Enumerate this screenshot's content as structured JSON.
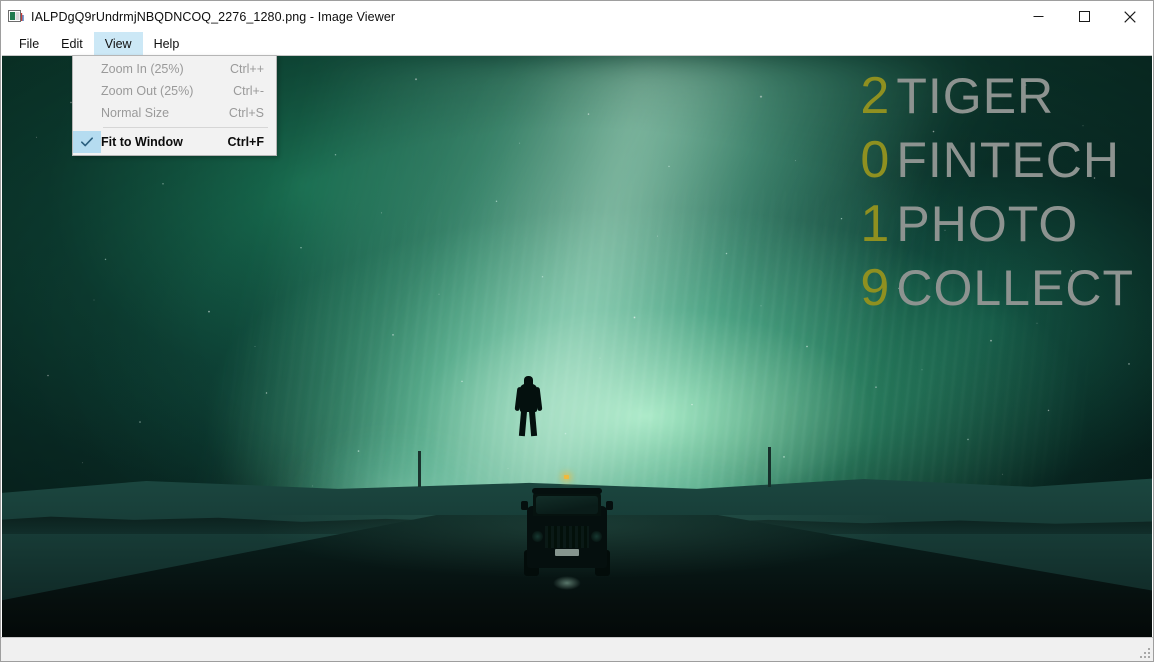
{
  "window": {
    "title": "IALPDgQ9rUndrmjNBQDNCOQ_2276_1280.png - Image Viewer",
    "app_icon": "image-file-icon",
    "controls": {
      "minimize_label": "Minimize",
      "maximize_label": "Maximize",
      "close_label": "Close"
    }
  },
  "menubar": {
    "items": [
      {
        "label": "File",
        "active": false
      },
      {
        "label": "Edit",
        "active": false
      },
      {
        "label": "View",
        "active": true
      },
      {
        "label": "Help",
        "active": false
      }
    ]
  },
  "view_menu": {
    "open": true,
    "items": [
      {
        "label": "Zoom In (25%)",
        "accel": "Ctrl++",
        "enabled": false,
        "checked": false
      },
      {
        "label": "Zoom Out (25%)",
        "accel": "Ctrl+-",
        "enabled": false,
        "checked": false
      },
      {
        "label": "Normal Size",
        "accel": "Ctrl+S",
        "enabled": false,
        "checked": false
      },
      {
        "label": "Fit to Window",
        "accel": "Ctrl+F",
        "enabled": true,
        "checked": true
      }
    ],
    "checkmark_glyph": "✓",
    "highlight_color": "#b5dcf0",
    "background_color": "#f2f2f2"
  },
  "photo": {
    "description": "Night landscape: a person standing on top of a jeep on a road under green aurora borealis",
    "overlay": {
      "digit_color": "#8f9020",
      "word_color": "#8d9390",
      "rows": [
        {
          "digit": "2",
          "word": "TIGER"
        },
        {
          "digit": "0",
          "word": "FINTECH"
        },
        {
          "digit": "1",
          "word": "PHOTO"
        },
        {
          "digit": "9",
          "word": "COLLECT"
        }
      ]
    },
    "colors": {
      "aurora_bright": "#96e4b4",
      "aurora_mid": "#1e8264",
      "sky_deep": "#051715",
      "snow": "#1b4740",
      "road": "#060f0e",
      "distant_light": "#f2b93c"
    }
  },
  "status_bar": {
    "text": ""
  }
}
